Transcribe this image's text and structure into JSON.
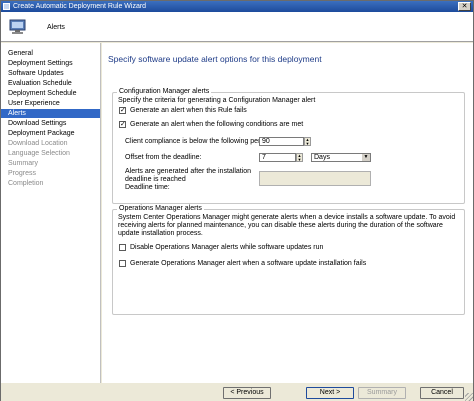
{
  "window": {
    "title": "Create Automatic Deployment Rule Wizard",
    "close_glyph": "✕"
  },
  "header": {
    "page_name": "Alerts"
  },
  "sidebar": {
    "items": [
      {
        "label": "General",
        "state": "normal"
      },
      {
        "label": "Deployment Settings",
        "state": "normal"
      },
      {
        "label": "Software Updates",
        "state": "normal"
      },
      {
        "label": "Evaluation Schedule",
        "state": "normal"
      },
      {
        "label": "Deployment Schedule",
        "state": "normal"
      },
      {
        "label": "User Experience",
        "state": "normal"
      },
      {
        "label": "Alerts",
        "state": "selected"
      },
      {
        "label": "Download Settings",
        "state": "normal"
      },
      {
        "label": "Deployment Package",
        "state": "normal"
      },
      {
        "label": "Download Location",
        "state": "disabled"
      },
      {
        "label": "Language Selection",
        "state": "disabled"
      },
      {
        "label": "Summary",
        "state": "disabled"
      },
      {
        "label": "Progress",
        "state": "disabled"
      },
      {
        "label": "Completion",
        "state": "disabled"
      }
    ]
  },
  "main": {
    "title": "Specify software update alert options for this deployment",
    "cm_group": {
      "legend": "Configuration Manager alerts",
      "description": "Specify the criteria for generating a Configuration Manager alert",
      "cb1_label": "Generate an alert when this Rule fails",
      "cb1_checked": true,
      "cb2_label": "Generate an alert when the following conditions are met",
      "cb2_checked": true,
      "compliance_label": "Client compliance is below the  following percent:",
      "compliance_value": "90",
      "offset_label": "Offset from the deadline:",
      "offset_value": "7",
      "offset_unit": "Days",
      "generated_label": "Alerts are generated after the installation deadline is reached",
      "deadline_label": "Deadline time:",
      "deadline_value": ""
    },
    "om_group": {
      "legend": "Operations Manager alerts",
      "description": "System Center Operations Manager might generate alerts when a device installs a software update. To avoid receiving alerts for planned maintenance, you can disable these alerts during the duration of the software update installation process.",
      "cb1_label": "Disable Operations Manager alerts while software updates run",
      "cb1_checked": false,
      "cb2_label": "Generate Operations Manager alert when a software update installation fails",
      "cb2_checked": false
    }
  },
  "footer": {
    "previous": "< Previous",
    "next": "Next >",
    "summary": "Summary",
    "cancel": "Cancel"
  }
}
